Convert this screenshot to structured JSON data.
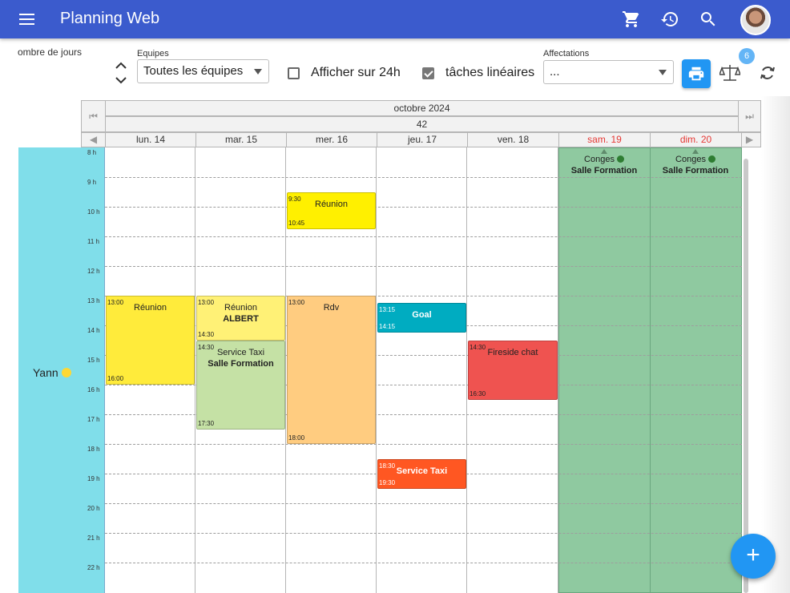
{
  "app": {
    "title": "Planning Web"
  },
  "header_icons": [
    "cart-icon",
    "history-icon",
    "search-icon"
  ],
  "toolbar": {
    "nb_jours_label": "ombre de jours",
    "equipes_label": "Equipes",
    "equipes_value": "Toutes les équipes",
    "afficher24_label": "Afficher sur 24h",
    "afficher24_checked": false,
    "taches_label": "tâches linéaires",
    "taches_checked": true,
    "affectations_label": "Affectations",
    "affectations_value": "...",
    "badge_count": "6"
  },
  "calendar": {
    "month": "octobre 2024",
    "week": "42",
    "days": [
      {
        "label": "lun. 14",
        "weekend": false
      },
      {
        "label": "mar. 15",
        "weekend": false
      },
      {
        "label": "mer. 16",
        "weekend": false
      },
      {
        "label": "jeu. 17",
        "weekend": false
      },
      {
        "label": "ven. 18",
        "weekend": false
      },
      {
        "label": "sam. 19",
        "weekend": true
      },
      {
        "label": "dim. 20",
        "weekend": true
      }
    ],
    "hours": [
      "8 h",
      "9 h",
      "10 h",
      "11 h",
      "12 h",
      "13 h",
      "14 h",
      "15 h",
      "16 h",
      "17 h",
      "18 h",
      "19 h",
      "20 h",
      "21 h",
      "22 h"
    ],
    "resource": {
      "name": "Yann",
      "dot_color": "#fdd835"
    },
    "events": [
      {
        "day": 0,
        "start": "13:00",
        "end": "16:00",
        "title": "Réunion",
        "color": "#ffeb3b"
      },
      {
        "day": 1,
        "start": "13:00",
        "end": "14:30",
        "title": "Réunion",
        "subtitle": "ALBERT",
        "color": "#fff176"
      },
      {
        "day": 1,
        "start": "14:30",
        "end": "17:30",
        "title": "Service Taxi",
        "subtitle": "Salle Formation",
        "color": "#c5e1a5"
      },
      {
        "day": 2,
        "start": "9:30",
        "end": "10:45",
        "title": "Réunion",
        "color": "#fff000"
      },
      {
        "day": 2,
        "start": "13:00",
        "end": "18:00",
        "title": "Rdv",
        "color": "#ffcc80"
      },
      {
        "day": 3,
        "start": "13:15",
        "end": "14:15",
        "title": "Goal",
        "color": "#00acc1",
        "light": true
      },
      {
        "day": 3,
        "start": "18:30",
        "end": "19:30",
        "title": "Service Taxi",
        "color": "#ff5722",
        "light": true
      },
      {
        "day": 4,
        "start": "14:30",
        "end": "16:30",
        "title": "Fireside chat",
        "color": "#ef5350"
      }
    ],
    "allday": [
      {
        "day": 5,
        "title": "Conges",
        "subtitle": "Salle Formation"
      },
      {
        "day": 6,
        "title": "Conges",
        "subtitle": "Salle Formation"
      }
    ]
  },
  "fab": {
    "label": "+"
  }
}
